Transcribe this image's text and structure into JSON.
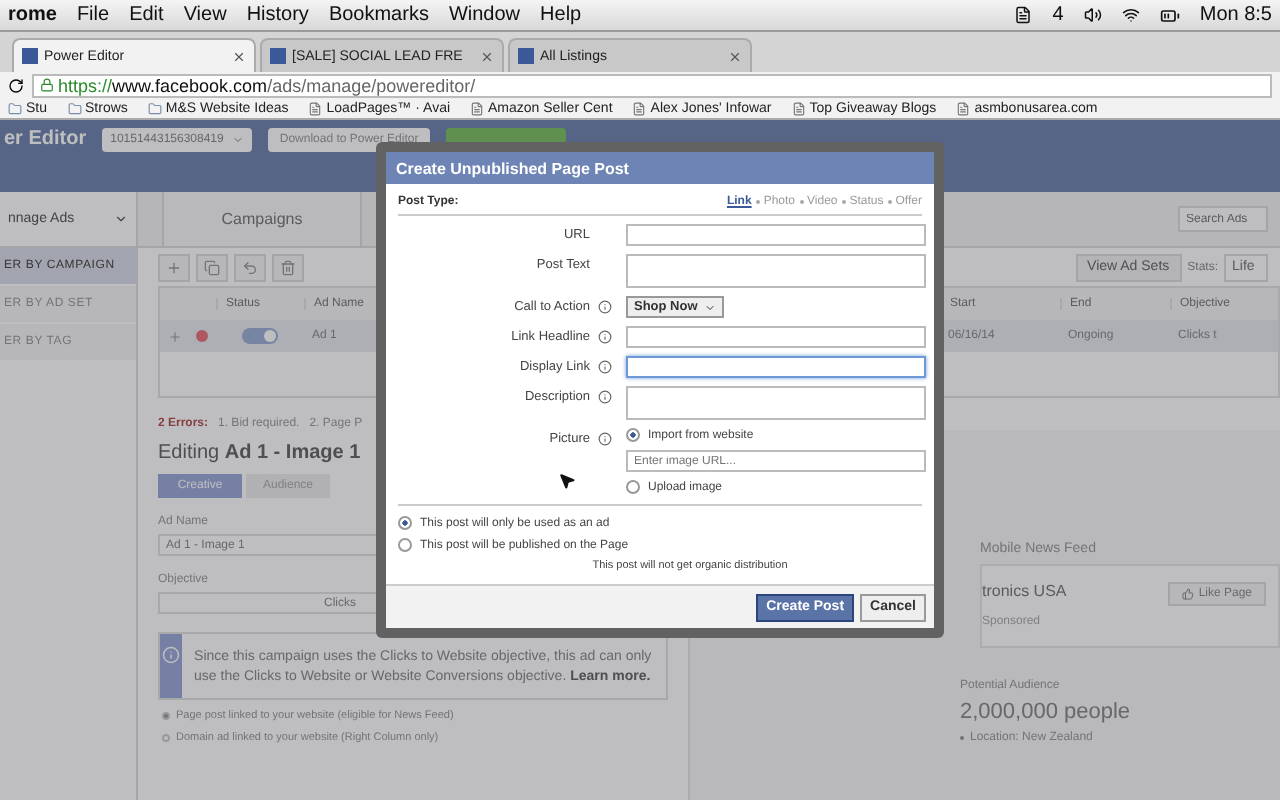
{
  "menubar": {
    "app": "rome",
    "items": [
      "File",
      "Edit",
      "View",
      "History",
      "Bookmarks",
      "Window",
      "Help"
    ],
    "badge": "4",
    "clock": "Mon 8:5"
  },
  "browser": {
    "tabs": [
      {
        "title": "Power Editor",
        "selected": true
      },
      {
        "title": "[SALE] SOCIAL LEAD FRE",
        "selected": false
      },
      {
        "title": "All Listings",
        "selected": false
      }
    ],
    "url_scheme": "https://",
    "url_host": "www.facebook.com",
    "url_path": "/ads/manage/powereditor/",
    "bookmarks": [
      {
        "label": "Stu",
        "kind": "folder"
      },
      {
        "label": "Strows",
        "kind": "folder"
      },
      {
        "label": "M&S Website Ideas",
        "kind": "folder"
      },
      {
        "label": "LoadPages™ · Avai",
        "kind": "page"
      },
      {
        "label": "Amazon Seller Cent",
        "kind": "page"
      },
      {
        "label": "Alex Jones' Infowar",
        "kind": "page"
      },
      {
        "label": "Top Giveaway Blogs",
        "kind": "page"
      },
      {
        "label": "asmbonusarea.com",
        "kind": "page"
      }
    ]
  },
  "app_header": {
    "title": "er Editor",
    "account": "10151443156308419",
    "download_button": "Download to Power Editor"
  },
  "sidebar": {
    "dropdown": "nnage Ads",
    "items": [
      {
        "label": "ER BY CAMPAIGN",
        "selected": true
      },
      {
        "label": "ER BY AD SET",
        "selected": false
      },
      {
        "label": "ER BY TAG",
        "selected": false
      }
    ]
  },
  "main": {
    "tabs": [
      {
        "label": "Campaigns",
        "selected": true
      }
    ],
    "search": {
      "placeholder": "Search Ads"
    },
    "view_button": "View Ad Sets",
    "stats_label": "Stats:",
    "stats_value": "Life",
    "table": {
      "columns": [
        "Status",
        "Ad Name",
        "Start",
        "End",
        "Objective"
      ],
      "rows": [
        {
          "error": true,
          "on": true,
          "cells": [
            "",
            "Ad 1",
            "06/16/14",
            "Ongoing",
            "Clicks t"
          ]
        }
      ]
    },
    "errors": {
      "label": "2 Errors:",
      "items": [
        "1. Bid required.",
        "2. Page P"
      ]
    }
  },
  "editor": {
    "prefix": "Editing",
    "title": "Ad 1 - Image 1",
    "steps": [
      {
        "label": "Creative",
        "selected": true
      },
      {
        "label": "Audience",
        "selected": false
      }
    ],
    "ad_name_label": "Ad Name",
    "ad_name": "Ad 1 - Image 1",
    "objective_label": "Objective",
    "objective_value": "Clicks",
    "info": "Since this campaign uses the Clicks to Website objective, this ad can only use the Clicks to Website or Website Conversions objective.",
    "info_link": "Learn more.",
    "options": [
      {
        "label": "Page post linked to your website (eligible for News Feed)",
        "selected": true
      },
      {
        "label": "Domain ad linked to your website (Right Column only)",
        "selected": false
      }
    ]
  },
  "preview": {
    "placement": "Mobile News Feed",
    "page_name": "tronics USA",
    "like_button": "Like Page",
    "sponsored": "Sponsored",
    "audience_label": "Potential Audience",
    "audience": "2,000,000 people",
    "location": "Location: New Zealand"
  },
  "dialog": {
    "title": "Create Unpublished Page Post",
    "post_type_label": "Post Type:",
    "post_types": [
      {
        "label": "Link",
        "selected": true
      },
      {
        "label": "Photo",
        "selected": false
      },
      {
        "label": "Video",
        "selected": false
      },
      {
        "label": "Status",
        "selected": false
      },
      {
        "label": "Offer",
        "selected": false
      }
    ],
    "fields": [
      {
        "kind": "input",
        "label": "URL",
        "info": false,
        "focused": false
      },
      {
        "kind": "textarea",
        "label": "Post Text",
        "info": false,
        "focused": false
      },
      {
        "kind": "select",
        "label": "Call to Action",
        "info": true,
        "focused": false,
        "value": "Shop Now"
      },
      {
        "kind": "input",
        "label": "Link Headline",
        "info": true,
        "focused": false
      },
      {
        "kind": "input",
        "label": "Display Link",
        "info": true,
        "focused": true
      },
      {
        "kind": "textarea",
        "label": "Description",
        "info": true,
        "focused": false
      }
    ],
    "picture": {
      "label": "Picture",
      "url_placeholder": "Enter image URL...",
      "options": [
        {
          "label": "Import from website",
          "selected": true
        },
        {
          "label": "Upload image",
          "selected": false
        }
      ]
    },
    "usage": [
      {
        "label": "This post will only be used as an ad",
        "selected": true
      },
      {
        "label": "This post will be published on the Page",
        "selected": false
      }
    ],
    "note": "This post will not get organic distribution",
    "buttons": [
      {
        "label": "Create Post",
        "kind": "primary"
      },
      {
        "label": "Cancel",
        "kind": "secondary"
      }
    ]
  }
}
